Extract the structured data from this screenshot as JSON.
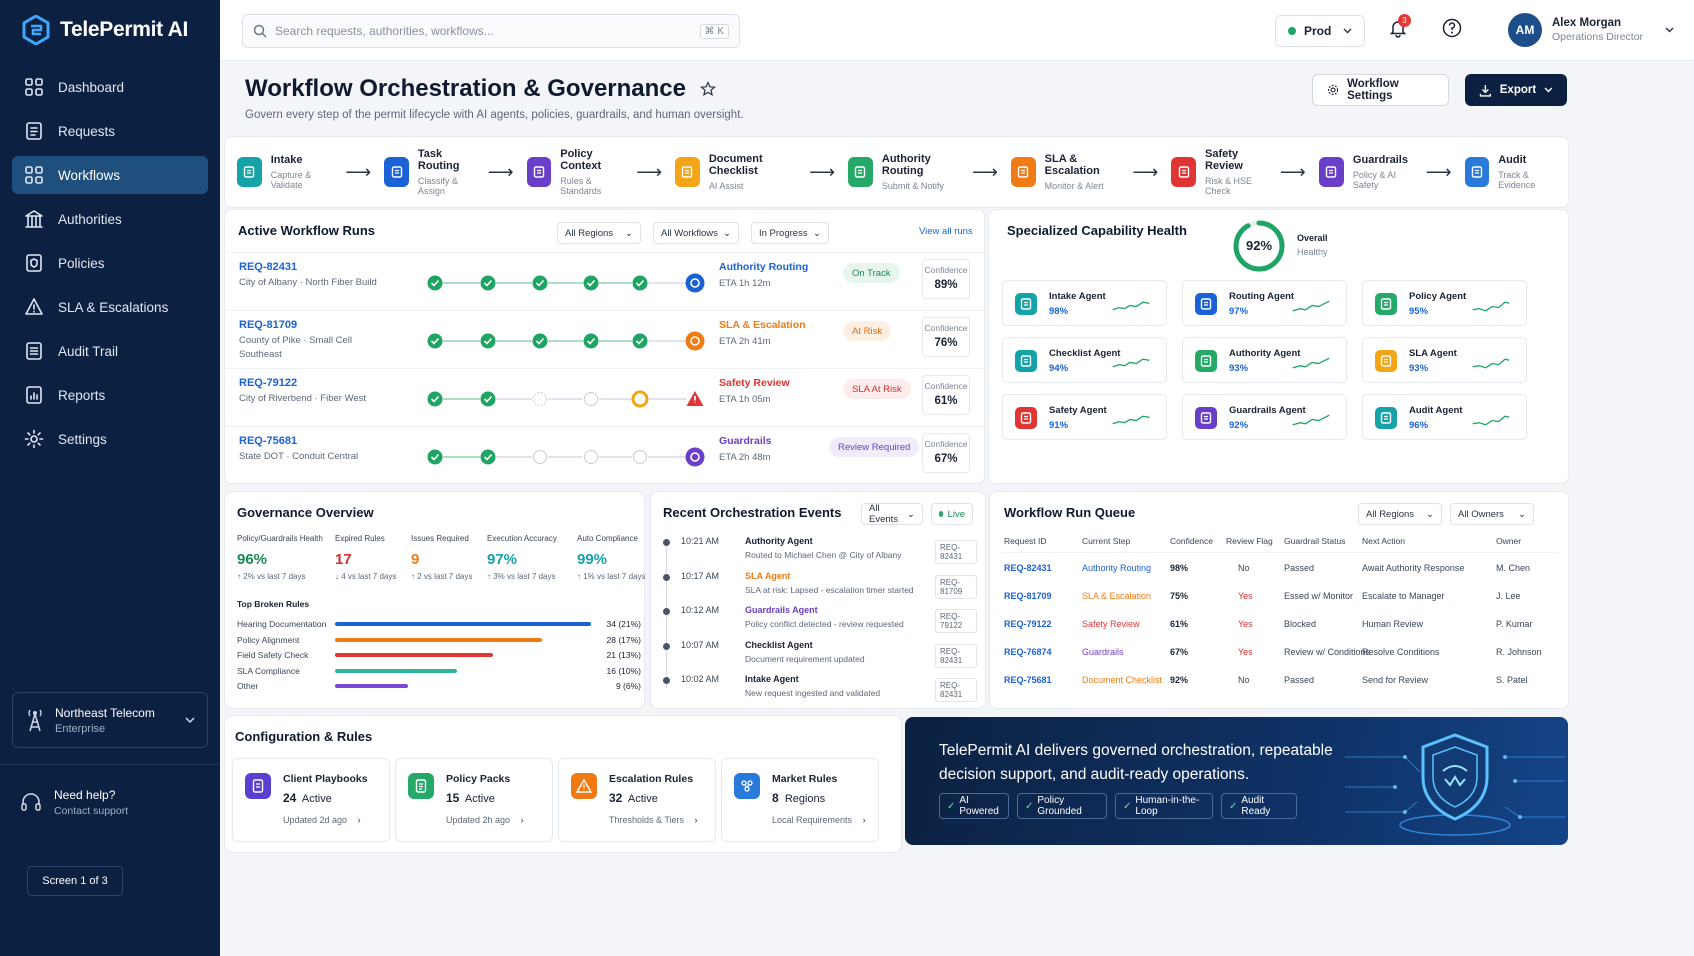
{
  "brand": {
    "name": "TelePermit AI",
    "accent": "#1a62d6",
    "sidebar_bg": "#0c2141"
  },
  "nav": [
    {
      "label": "Dashboard",
      "icon": "grid-icon"
    },
    {
      "label": "Requests",
      "icon": "document-icon"
    },
    {
      "label": "Workflows",
      "icon": "grid-icon",
      "active": true
    },
    {
      "label": "Authorities",
      "icon": "building-icon"
    },
    {
      "label": "Policies",
      "icon": "shield-document-icon"
    },
    {
      "label": "SLA & Escalations",
      "icon": "alert-icon"
    },
    {
      "label": "Audit Trail",
      "icon": "list-icon"
    },
    {
      "label": "Reports",
      "icon": "report-icon"
    },
    {
      "label": "Settings",
      "icon": "gear-icon"
    }
  ],
  "org": {
    "name": "Northeast Telecom",
    "tier": "Enterprise"
  },
  "help": {
    "title": "Need help?",
    "sub": "Contact support"
  },
  "screen_indicator": "Screen 1 of 3",
  "topbar": {
    "search_placeholder": "Search requests, authorities, workflows...",
    "search_shortcut": "⌘ K",
    "env": "Prod",
    "notifications": "3",
    "user": {
      "initials": "AM",
      "name": "Alex Morgan",
      "role": "Operations Director"
    }
  },
  "page": {
    "title": "Workflow Orchestration & Governance",
    "subtitle": "Govern every step of the permit lifecycle with AI agents, policies, guardrails, and human oversight.",
    "settings_label": "Workflow Settings",
    "export_label": "Export"
  },
  "pipeline": [
    {
      "name": "Intake",
      "desc": "Capture & Validate",
      "color": "#15a3a8"
    },
    {
      "name": "Task Routing",
      "desc": "Classify & Assign",
      "color": "#1a62d6"
    },
    {
      "name": "Policy Context",
      "desc": "Rules & Standards",
      "color": "#6a3fc8"
    },
    {
      "name": "Document Checklist",
      "desc": "AI Assist",
      "color": "#f2a516"
    },
    {
      "name": "Authority Routing",
      "desc": "Submit & Notify",
      "color": "#26a869"
    },
    {
      "name": "SLA & Escalation",
      "desc": "Monitor & Alert",
      "color": "#f07a14"
    },
    {
      "name": "Safety Review",
      "desc": "Risk & HSE Check",
      "color": "#e03535"
    },
    {
      "name": "Guardrails",
      "desc": "Policy & AI Safety",
      "color": "#6a3fc8"
    },
    {
      "name": "Audit",
      "desc": "Track & Evidence",
      "color": "#2a7ad9"
    }
  ],
  "runs": {
    "title": "Active Workflow Runs",
    "filters": [
      "All Regions",
      "All Workflows",
      "In Progress"
    ],
    "view_all": "View all runs",
    "confidence_label": "Confidence",
    "items": [
      {
        "id": "REQ-82431",
        "loc": "City of Albany · North Fiber Build",
        "step": "Authority Routing",
        "step_color": "#1a62d6",
        "eta": "ETA 1h 12m",
        "status": "On Track",
        "status_fg": "#1a8a52",
        "status_bg": "#e6f6ee",
        "conf": "89%",
        "done": 5,
        "current": "#1a62d6",
        "current_kind": "authority"
      },
      {
        "id": "REQ-81709",
        "loc": "County of Pike · Small Cell Southeast",
        "step": "SLA & Escalation",
        "step_color": "#f07a14",
        "eta": "ETA 2h 41m",
        "status": "At Risk",
        "status_fg": "#d96a10",
        "status_bg": "#fdf0e3",
        "conf": "76%",
        "done": 5,
        "current": "#f07a14",
        "current_kind": "clock"
      },
      {
        "id": "REQ-79122",
        "loc": "City of Riverbend · Fiber West",
        "step": "Safety Review",
        "step_color": "#e03535",
        "eta": "ETA 1h 05m",
        "status": "SLA At Risk",
        "status_fg": "#d32f2f",
        "status_bg": "#fdecec",
        "conf": "61%",
        "done": 2,
        "current": "#e03535",
        "current_kind": "warning"
      },
      {
        "id": "REQ-75681",
        "loc": "State DOT · Conduit Central",
        "step": "Guardrails",
        "step_color": "#6a3fc8",
        "eta": "ETA 2h 48m",
        "status": "Review Required",
        "status_fg": "#6a3fc8",
        "status_bg": "#f1ecfb",
        "conf": "67%",
        "done": 2,
        "current": "#6a3fc8",
        "current_kind": "shield"
      }
    ]
  },
  "health": {
    "title": "Specialized Capability Health",
    "overall_value": "92%",
    "overall_pct": 92,
    "overall_label": "Overall",
    "overall_status": "Healthy",
    "agents": [
      {
        "name": "Intake Agent",
        "pct": "98%",
        "color": "#15a3a8"
      },
      {
        "name": "Routing Agent",
        "pct": "97%",
        "color": "#1a62d6"
      },
      {
        "name": "Policy Agent",
        "pct": "95%",
        "color": "#26a869"
      },
      {
        "name": "Checklist Agent",
        "pct": "94%",
        "color": "#15a3a8"
      },
      {
        "name": "Authority Agent",
        "pct": "93%",
        "color": "#26a869"
      },
      {
        "name": "SLA Agent",
        "pct": "93%",
        "color": "#f2a516"
      },
      {
        "name": "Safety Agent",
        "pct": "91%",
        "color": "#e03535"
      },
      {
        "name": "Guardrails Agent",
        "pct": "92%",
        "color": "#6a3fc8"
      },
      {
        "name": "Audit Agent",
        "pct": "96%",
        "color": "#15a3a8"
      }
    ]
  },
  "governance": {
    "title": "Governance Overview",
    "kpis": [
      {
        "label": "Policy/Guardrails Health",
        "value": "96%",
        "delta": "↑ 2% vs last 7 days",
        "color": "#1a8a52"
      },
      {
        "label": "Expired Rules",
        "value": "17",
        "delta": "↓ 4 vs last 7 days",
        "color": "#d32f2f"
      },
      {
        "label": "Issues Required",
        "value": "9",
        "delta": "↑ 2 vs last 7 days",
        "color": "#f07a14"
      },
      {
        "label": "Execution Accuracy",
        "value": "97%",
        "delta": "↑ 3% vs last 7 days",
        "color": "#15a3a8"
      },
      {
        "label": "Auto Compliance",
        "value": "99%",
        "delta": "↑ 1% vs last 7 days",
        "color": "#15a3a8"
      }
    ],
    "broken_title": "Top Broken Rules",
    "broken": [
      {
        "label": "Hearing Documentation",
        "value": "34 (21%)",
        "pct": 21,
        "color": "#1a62d6"
      },
      {
        "label": "Policy Alignment",
        "value": "28 (17%)",
        "pct": 17,
        "color": "#f07a14"
      },
      {
        "label": "Field Safety Check",
        "value": "21 (13%)",
        "pct": 13,
        "color": "#e03535"
      },
      {
        "label": "SLA Compliance",
        "value": "16 (10%)",
        "pct": 10,
        "color": "#2bb89a"
      },
      {
        "label": "Other",
        "value": "9 (6%)",
        "pct": 6,
        "color": "#7b48d6"
      }
    ]
  },
  "events": {
    "title": "Recent Orchestration Events",
    "filter": "All Events",
    "live": "Live",
    "items": [
      {
        "time": "10:21 AM",
        "agent": "Authority Agent",
        "color": "#1a2233",
        "desc": "Routed to Michael Chen @ City of Albany",
        "ref": "REQ-82431"
      },
      {
        "time": "10:17 AM",
        "agent": "SLA Agent",
        "color": "#f07a14",
        "desc": "SLA at risk: Lapsed - escalation timer started",
        "ref": "REQ-81709"
      },
      {
        "time": "10:12 AM",
        "agent": "Guardrails Agent",
        "color": "#6a3fc8",
        "desc": "Policy conflict detected - review requested",
        "ref": "REQ-79122"
      },
      {
        "time": "10:07 AM",
        "agent": "Checklist Agent",
        "color": "#1a2233",
        "desc": "Document requirement updated",
        "ref": "REQ-82431"
      },
      {
        "time": "10:02 AM",
        "agent": "Intake Agent",
        "color": "#1a2233",
        "desc": "New request ingested and validated",
        "ref": "REQ-82431"
      }
    ]
  },
  "queue": {
    "title": "Workflow Run Queue",
    "filters": [
      "All Regions",
      "All Owners"
    ],
    "headers": [
      "Request ID",
      "Current Step",
      "Confidence",
      "Review Flag",
      "Guardrail Status",
      "Next Action",
      "Owner"
    ],
    "rows": [
      {
        "id": "REQ-82431",
        "step": "Authority Routing",
        "step_color": "#1a62d6",
        "conf": "98%",
        "flag": "No",
        "flag_color": "#3a4556",
        "guard": "Passed",
        "next": "Await Authority Response",
        "owner": "M. Chen"
      },
      {
        "id": "REQ-81709",
        "step": "SLA & Escalation",
        "step_color": "#f07a14",
        "conf": "75%",
        "flag": "Yes",
        "flag_color": "#d32f2f",
        "guard": "Essed w/ Monitor",
        "next": "Escalate to Manager",
        "owner": "J. Lee"
      },
      {
        "id": "REQ-79122",
        "step": "Safety Review",
        "step_color": "#e03535",
        "conf": "61%",
        "flag": "Yes",
        "flag_color": "#d32f2f",
        "guard": "Blocked",
        "next": "Human Review",
        "owner": "P. Kumar"
      },
      {
        "id": "REQ-76874",
        "step": "Guardrails",
        "step_color": "#6a3fc8",
        "conf": "67%",
        "flag": "Yes",
        "flag_color": "#d32f2f",
        "guard": "Review w/ Conditions",
        "next": "Resolve Conditions",
        "owner": "R. Johnson"
      },
      {
        "id": "REQ-75681",
        "step": "Document Checklist",
        "step_color": "#f07a14",
        "conf": "92%",
        "flag": "No",
        "flag_color": "#3a4556",
        "guard": "Passed",
        "next": "Send for Review",
        "owner": "S. Patel"
      }
    ]
  },
  "config": {
    "title": "Configuration & Rules",
    "items": [
      {
        "name": "Client Playbooks",
        "count": "24",
        "unit": "Active",
        "foot": "Updated 2d ago",
        "color": "#5a3fd0"
      },
      {
        "name": "Policy Packs",
        "count": "15",
        "unit": "Active",
        "foot": "Updated 2h ago",
        "color": "#26a869"
      },
      {
        "name": "Escalation Rules",
        "count": "32",
        "unit": "Active",
        "foot": "Thresholds & Tiers",
        "color": "#f07a14"
      },
      {
        "name": "Market Rules",
        "count": "8",
        "unit": "Regions",
        "foot": "Local Requirements",
        "color": "#2a7ad9"
      }
    ]
  },
  "banner": {
    "text": "TelePermit AI delivers governed orchestration, repeatable decision support, and audit-ready operations.",
    "pills": [
      "AI Powered",
      "Policy Grounded",
      "Human-in-the-Loop",
      "Audit Ready"
    ]
  }
}
